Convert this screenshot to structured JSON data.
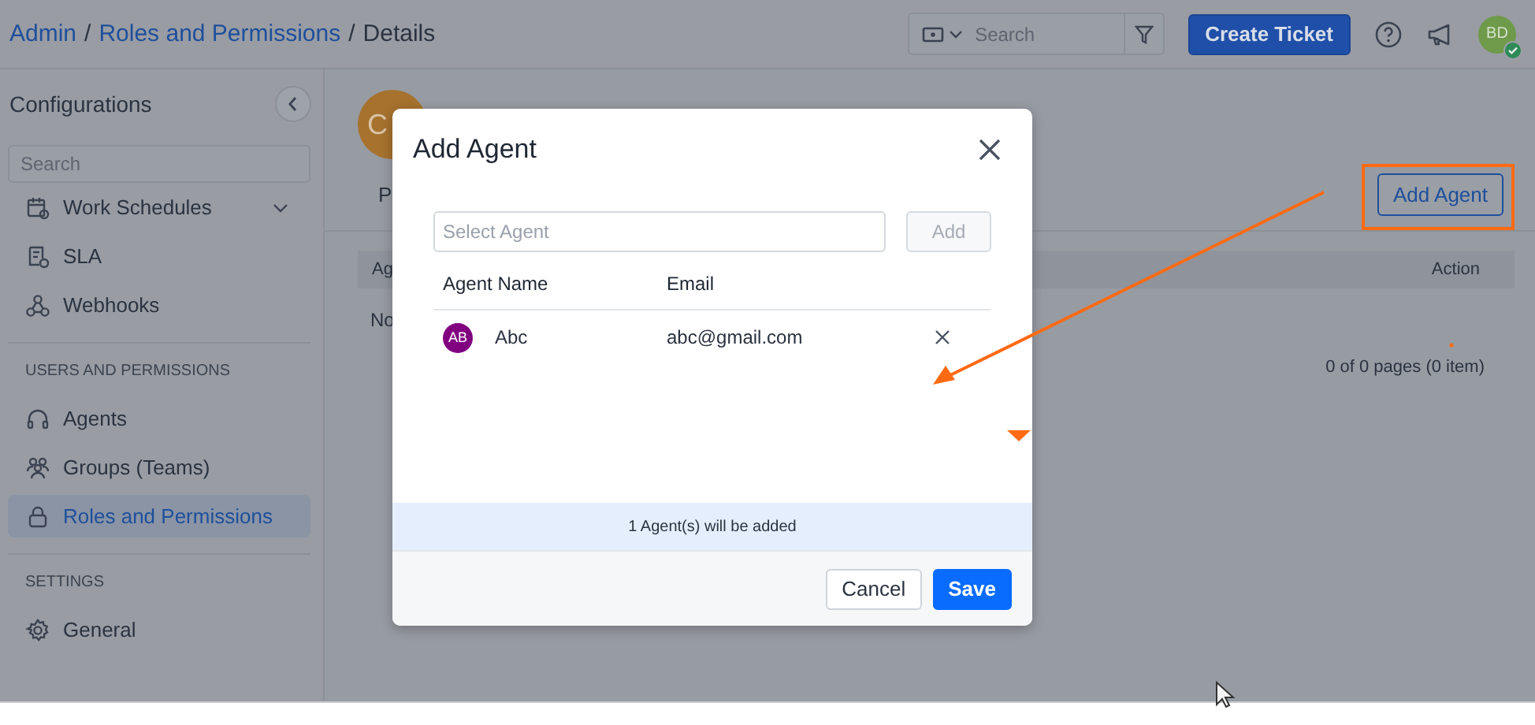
{
  "breadcrumb": {
    "separator": "/",
    "items": [
      {
        "label": "Admin",
        "kind": "link"
      },
      {
        "label": "Roles and Permissions",
        "kind": "link"
      },
      {
        "label": "Details",
        "kind": "current"
      }
    ]
  },
  "header": {
    "search": {
      "placeholder": "Search"
    },
    "create_button": "Create Ticket",
    "user": {
      "initials": "BD",
      "online": true
    }
  },
  "sidebar": {
    "title": "Configurations",
    "search": {
      "placeholder": "Search"
    },
    "sections": [
      {
        "items": [
          {
            "label": "Work Schedules",
            "kind": "dropdown",
            "selected": false
          },
          {
            "label": "SLA",
            "kind": "link",
            "selected": false
          },
          {
            "label": "Webhooks",
            "kind": "link",
            "selected": false
          }
        ]
      },
      {
        "heading": "USERS AND PERMISSIONS",
        "items": [
          {
            "label": "Agents",
            "kind": "link",
            "selected": false
          },
          {
            "label": "Groups (Teams)",
            "kind": "link",
            "selected": false
          },
          {
            "label": "Roles and Permissions",
            "kind": "link",
            "selected": true
          }
        ]
      },
      {
        "heading": "SETTINGS",
        "items": [
          {
            "label": "General",
            "kind": "link",
            "selected": false
          }
        ]
      }
    ]
  },
  "page": {
    "avatar_letter": "C",
    "tab": "P",
    "add_button": "Add Agent",
    "table": {
      "columns": [
        "Ag",
        "Action"
      ],
      "empty_text": "No"
    },
    "pagination": "0 of 0 pages (0 item)"
  },
  "modal": {
    "title": "Add Agent",
    "select": {
      "placeholder": "Select Agent"
    },
    "add_button": {
      "label": "Add",
      "disabled": true
    },
    "columns": [
      "Agent Name",
      "Email"
    ],
    "rows": [
      {
        "initials": "AB",
        "name": "Abc",
        "email": "abc@gmail.com"
      }
    ],
    "notice": "1 Agent(s) will be added",
    "buttons": [
      {
        "label": "Cancel",
        "kind": "secondary"
      },
      {
        "label": "Save",
        "kind": "primary"
      }
    ]
  }
}
